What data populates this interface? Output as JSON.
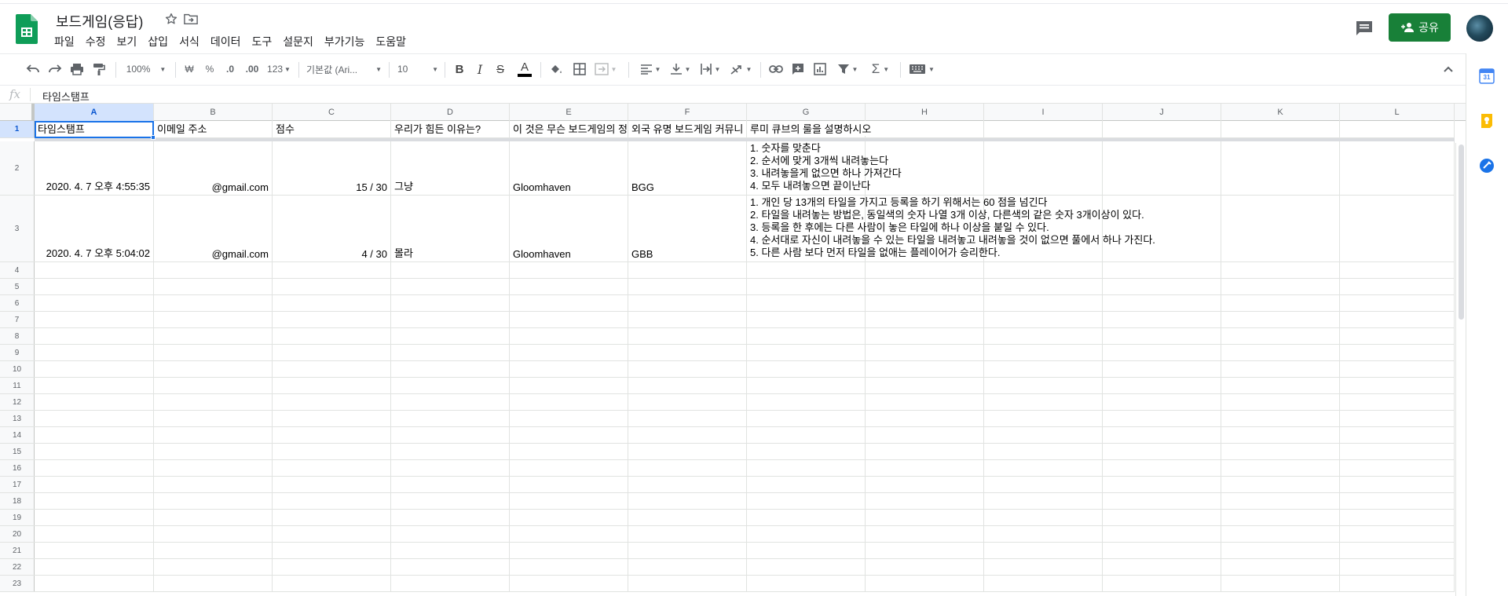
{
  "app": {
    "doc_title": "보드게임(응답)",
    "menu": [
      "파일",
      "수정",
      "보기",
      "삽입",
      "서식",
      "데이터",
      "도구",
      "설문지",
      "부가기능",
      "도움말"
    ],
    "share_label": "공유",
    "brand_color": "#188038",
    "icons": {
      "logo": "sheets-logo-icon",
      "star": "star-icon",
      "move": "move-to-folder-icon",
      "comments": "comment-icon",
      "account": "avatar"
    }
  },
  "toolbar": {
    "zoom": "100%",
    "currency": "₩",
    "percent": "%",
    "decrease_decimal": ".0",
    "increase_decimal": ".00",
    "more_formats": "123",
    "font_family": "기본값 (Ari...",
    "font_size": "10",
    "bold": "B",
    "italic": "I",
    "strike": "S",
    "text_color": "A"
  },
  "formula_bar": {
    "fx": "fx",
    "value": "타임스탬프"
  },
  "sheet": {
    "selected_cell": "A1",
    "columns": [
      "A",
      "B",
      "C",
      "D",
      "E",
      "F",
      "G",
      "H",
      "I",
      "J",
      "K",
      "L"
    ],
    "header_row": [
      "타임스탬프",
      "이메일 주소",
      "점수",
      "우리가 힘든 이유는?",
      "이 것은 무슨 보드게임의 정",
      "외국 유명 보드게임 커뮤니",
      "루미 큐브의 룰을 설명하시오"
    ],
    "rows": [
      {
        "num": "2",
        "timestamp": "2020. 4. 7 오후 4:55:35",
        "email": "@gmail.com",
        "score": "15 / 30",
        "reason": "그냥",
        "game": "Gloomhaven",
        "community": "BGG",
        "rules": "1. 숫자를 맞춘다\n2. 순서에 맞게 3개씩 내려놓는다\n3. 내려놓을게 없으면 하나 가져간다\n4. 모두 내려놓으면 끝이난다"
      },
      {
        "num": "3",
        "timestamp": "2020. 4. 7 오후 5:04:02",
        "email": "@gmail.com",
        "score": "4 / 30",
        "reason": "몰라",
        "game": "Gloomhaven",
        "community": "GBB",
        "rules": "1. 개인 당 13개의 타일을 가지고 등록을 하기 위해서는 60 점을 넘긴다\n2. 타일을 내려놓는 방법은, 동일색의 숫자 나열 3개 이상, 다른색의 같은 숫자 3개이상이 있다.\n3. 등록을 한 후에는 다른 사람이 놓은 타일에 하나 이상을 붙일 수 있다.\n4. 순서대로 자신이 내려놓을 수 있는 타일을 내려놓고 내려놓을 것이 없으면 풀에서 하나 가진다.\n5. 다른 사람 보다 먼저 타일을 없애는 플레이어가 승리한다."
      }
    ],
    "empty_row_numbers": [
      "4",
      "5",
      "6",
      "7",
      "8",
      "9",
      "10",
      "11",
      "12",
      "13",
      "14",
      "15",
      "16",
      "17",
      "18",
      "19",
      "20",
      "21",
      "22",
      "23"
    ]
  },
  "side_panel": {
    "calendar_label": "31",
    "icons": [
      "calendar-icon",
      "keep-icon",
      "tasks-icon"
    ]
  }
}
